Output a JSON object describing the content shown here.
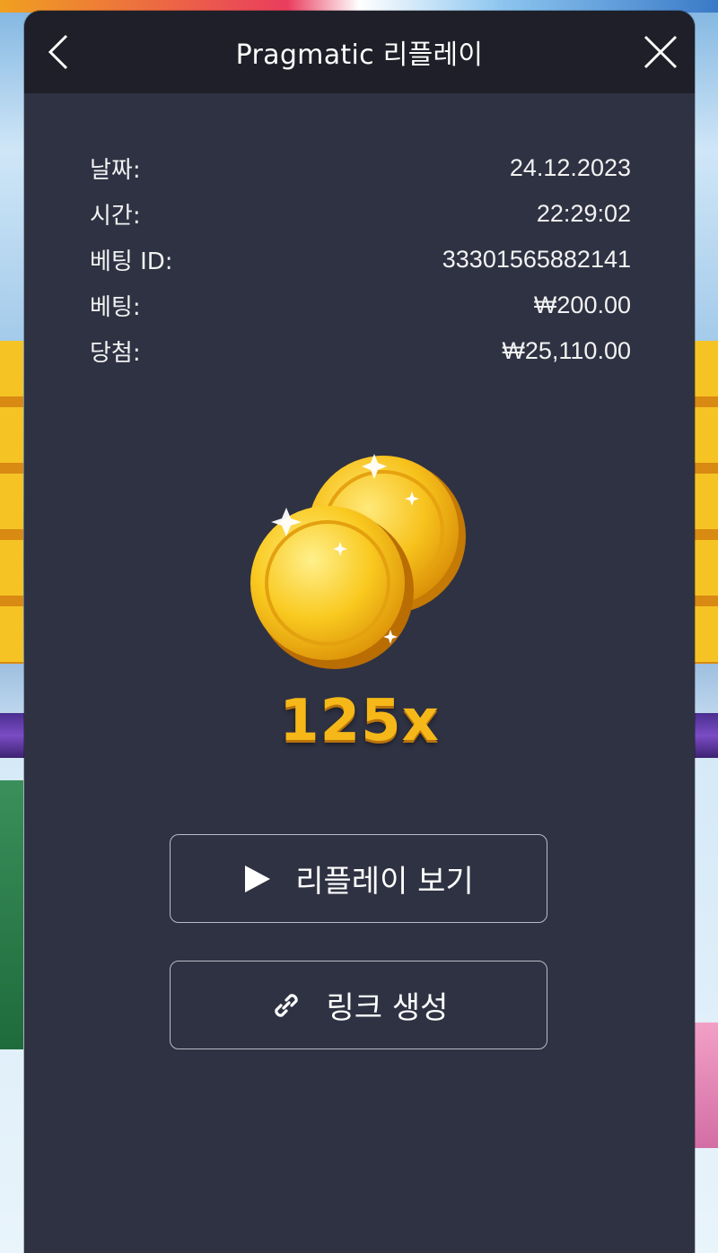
{
  "header": {
    "title": "Pragmatic 리플레이"
  },
  "info": [
    {
      "label": "날짜:",
      "value": "24.12.2023"
    },
    {
      "label": "시간:",
      "value": "22:29:02"
    },
    {
      "label": "베팅 ID:",
      "value": "33301565882141"
    },
    {
      "label": "베팅:",
      "value": "₩200.00"
    },
    {
      "label": "당첨:",
      "value": "₩25,110.00"
    }
  ],
  "result": {
    "multiplier": "125x"
  },
  "actions": {
    "replay_label": "리플레이 보기",
    "link_label": "링크 생성"
  },
  "icons": {
    "back": "chevron-left-icon",
    "close": "close-icon",
    "play": "play-icon",
    "link": "link-icon",
    "coins": "gold-coins-icon"
  },
  "colors": {
    "modal_bg": "#2f3242",
    "header_bg": "#1e1f28",
    "multiplier": "#f5b818"
  }
}
